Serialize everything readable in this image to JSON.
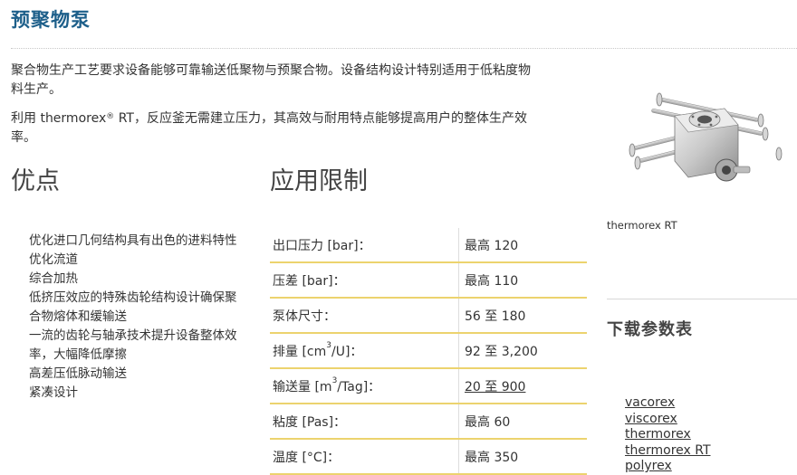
{
  "page": {
    "title": "预聚物泵",
    "intro_p1": "聚合物生产工艺要求设备能够可靠输送低聚物与预聚合物。设备结构设计特别适用于低粘度物料生产。",
    "intro_p2_before": "利用 thermorex",
    "intro_p2_sup": "®",
    "intro_p2_after": " RT，反应釜无需建立压力，其高效与耐用特点能够提高用户的整体生产效率。"
  },
  "advantages": {
    "heading": "优点",
    "items": [
      "优化进口几何结构具有出色的进料特性",
      "优化流道",
      "综合加热",
      "低挤压效应的特殊齿轮结构设计确保聚合物熔体和缓输送",
      "一流的齿轮与轴承技术提升设备整体效率，大幅降低摩擦",
      "高差压低脉动输送",
      "紧凑设计"
    ]
  },
  "limits": {
    "heading": "应用限制",
    "rows": [
      {
        "param": "出口压力 [bar]：",
        "value": "最高 120"
      },
      {
        "param": "压差 [bar]：",
        "value": "最高 110"
      },
      {
        "param": "泵体尺寸：",
        "value": "56 至 180"
      },
      {
        "param_before": "排量 [cm",
        "param_sup": "3",
        "param_after": "/U]：",
        "value": "92 至 3,200"
      },
      {
        "param_before": "输送量 [m",
        "param_sup": "3",
        "param_after": "/Tag]：",
        "value": "20 至 900",
        "value_is_link": true
      },
      {
        "param": "粘度 [Pas]：",
        "value": "最高 60"
      },
      {
        "param": "温度 [°C]：",
        "value": "最高 350"
      }
    ]
  },
  "sidebar": {
    "product_caption": "thermorex RT",
    "download_title": "下载参数表",
    "downloads": [
      "vacorex",
      "viscorex",
      "thermorex",
      "thermorex RT",
      "polyrex"
    ]
  },
  "colors": {
    "title": "#1d5f8a",
    "table_rule": "#ecd36e"
  }
}
